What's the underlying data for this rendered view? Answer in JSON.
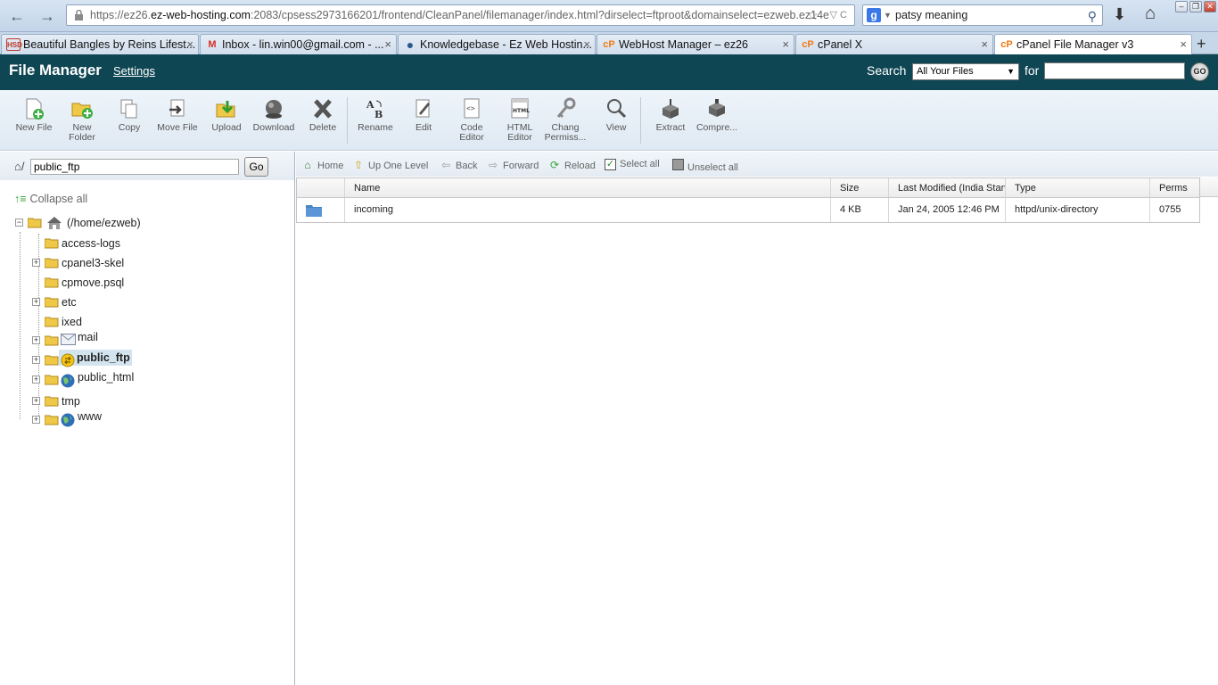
{
  "browser": {
    "url_prefix": "https://ez26.",
    "url_host": "ez-web-hosting.com",
    "url_rest": ":2083/cpsess2973166201/frontend/CleanPanel/filemanager/index.html?dirselect=ftproot&domainselect=ezweb.ez14e",
    "search_value": "patsy meaning",
    "tabs": [
      {
        "title": "Beautiful Bangles by Reins Lifest...",
        "icon": "HSD",
        "icon_color": "#c0392b"
      },
      {
        "title": "Inbox - lin.win00@gmail.com - ...",
        "icon": "M",
        "icon_color": "#d93025"
      },
      {
        "title": "Knowledgebase - Ez Web Hostin...",
        "icon": "●",
        "icon_color": "#2a5a8c"
      },
      {
        "title": "WebHost Manager – ez26",
        "icon": "cP",
        "icon_color": "#f07a14"
      },
      {
        "title": "cPanel X",
        "icon": "cP",
        "icon_color": "#f07a14"
      },
      {
        "title": "cPanel File Manager v3",
        "icon": "cP",
        "icon_color": "#f07a14"
      }
    ]
  },
  "header": {
    "title": "File Manager",
    "settings_label": "Settings",
    "search_label": "Search",
    "search_scope": "All Your Files",
    "for_label": "for",
    "go_label": "GO"
  },
  "toolbar": {
    "items": [
      {
        "line1": "New File",
        "line2": ""
      },
      {
        "line1": "New",
        "line2": "Folder"
      },
      {
        "line1": "Copy",
        "line2": ""
      },
      {
        "line1": "Move File",
        "line2": ""
      },
      {
        "line1": "Upload",
        "line2": ""
      },
      {
        "line1": "Download",
        "line2": ""
      },
      {
        "line1": "Delete",
        "line2": ""
      },
      {
        "line1": "Rename",
        "line2": ""
      },
      {
        "line1": "Edit",
        "line2": ""
      },
      {
        "line1": "Code",
        "line2": "Editor"
      },
      {
        "line1": "HTML",
        "line2": "Editor"
      },
      {
        "line1": "Chang",
        "line2": "Permiss..."
      },
      {
        "line1": "View",
        "line2": ""
      },
      {
        "line1": "Extract",
        "line2": ""
      },
      {
        "line1": "Compre...",
        "line2": ""
      }
    ]
  },
  "left": {
    "path_value": "public_ftp",
    "go_label": "Go",
    "collapse_all": "Collapse all",
    "root_label": "(/home/ezweb)",
    "tree": [
      {
        "label": "access-logs"
      },
      {
        "label": "cpanel3-skel"
      },
      {
        "label": "cpmove.psql"
      },
      {
        "label": "etc"
      },
      {
        "label": "ixed"
      },
      {
        "label": "mail"
      },
      {
        "label": "public_ftp"
      },
      {
        "label": "public_html"
      },
      {
        "label": "tmp"
      },
      {
        "label": "www"
      }
    ]
  },
  "nav": {
    "home": "Home",
    "up": "Up One Level",
    "back": "Back",
    "forward": "Forward",
    "reload": "Reload",
    "select_all": "Select all",
    "unselect_all": "Unselect all"
  },
  "table": {
    "headers": {
      "name": "Name",
      "size": "Size",
      "modified": "Last Modified (India Standard Time)",
      "type": "Type",
      "perms": "Perms"
    },
    "rows": [
      {
        "name": "incoming",
        "size": "4 KB",
        "modified": "Jan 24, 2005 12:46 PM",
        "type": "httpd/unix-directory",
        "perms": "0755"
      }
    ]
  }
}
